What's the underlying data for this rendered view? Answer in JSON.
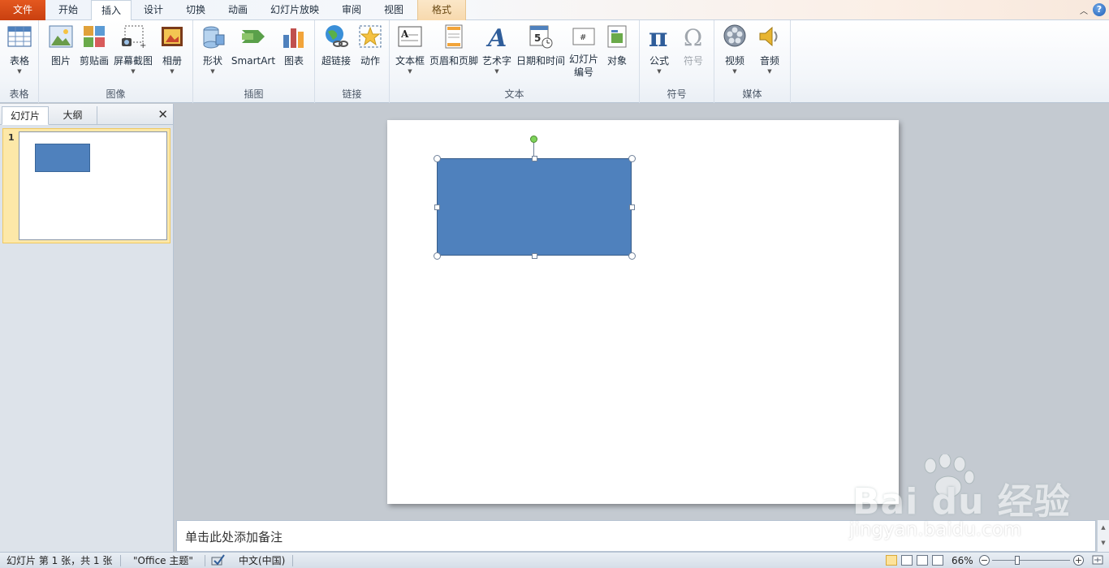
{
  "tabs": [
    {
      "label": "文件",
      "type": "file"
    },
    {
      "label": "开始",
      "type": "normal"
    },
    {
      "label": "插入",
      "type": "active"
    },
    {
      "label": "设计",
      "type": "normal"
    },
    {
      "label": "切换",
      "type": "normal"
    },
    {
      "label": "动画",
      "type": "normal"
    },
    {
      "label": "幻灯片放映",
      "type": "normal"
    },
    {
      "label": "审阅",
      "type": "normal"
    },
    {
      "label": "视图",
      "type": "normal"
    },
    {
      "label": "格式",
      "type": "context"
    }
  ],
  "ribbon": {
    "groups": {
      "table": {
        "label": "表格",
        "buttons": {
          "table": "表格"
        }
      },
      "image": {
        "label": "图像",
        "buttons": {
          "picture": "图片",
          "clipart": "剪贴画",
          "screenshot": "屏幕截图",
          "album": "相册"
        }
      },
      "illustration": {
        "label": "插图",
        "buttons": {
          "shapes": "形状",
          "smartart": "SmartArt",
          "chart": "图表"
        }
      },
      "links": {
        "label": "链接",
        "buttons": {
          "hyperlink": "超链接",
          "action": "动作"
        }
      },
      "text": {
        "label": "文本",
        "buttons": {
          "textbox": "文本框",
          "header_footer": "页眉和页脚",
          "wordart": "艺术字",
          "datetime": "日期和时间",
          "slide_number_1": "幻灯片",
          "slide_number_2": "编号",
          "object": "对象"
        }
      },
      "symbols": {
        "label": "符号",
        "buttons": {
          "equation": "公式",
          "symbol": "符号"
        }
      },
      "media": {
        "label": "媒体",
        "buttons": {
          "video": "视频",
          "audio": "音频"
        }
      }
    }
  },
  "leftpanel": {
    "tabs": {
      "slides": "幻灯片",
      "outline": "大纲"
    },
    "slide_number": "1"
  },
  "notes": {
    "placeholder": "单击此处添加备注"
  },
  "status": {
    "slide_info": "幻灯片 第 1 张，共 1 张",
    "theme": "\"Office 主题\"",
    "language": "中文(中国)",
    "zoom": "66%",
    "zoom_level": 0.66
  },
  "watermark": {
    "brand": "Bai du 经验",
    "url": "jingyan.baidu.com"
  },
  "colors": {
    "shape_fill": "#4f81bd",
    "shape_border": "#385d8a",
    "file_tab": "#d24c17",
    "rotation_handle": "#7ed35a"
  }
}
